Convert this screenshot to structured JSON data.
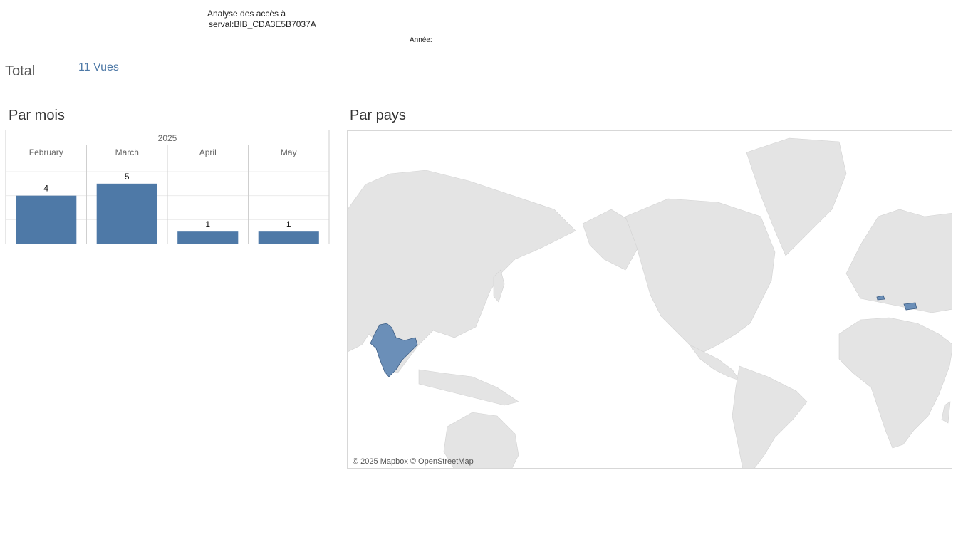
{
  "header": {
    "title_line1": "Analyse des accès à",
    "title_line2": "serval:BIB_CDA3E5B7037A",
    "year_filter_label": "Année:"
  },
  "summary": {
    "total_label": "Total",
    "total_value": "11 Vues"
  },
  "sections": {
    "months_heading": "Par mois",
    "countries_heading": "Par pays"
  },
  "chart_data": {
    "type": "bar",
    "year_header": "2025",
    "categories": [
      "February",
      "March",
      "April",
      "May"
    ],
    "values": [
      4,
      5,
      1,
      1
    ],
    "ylim": [
      0,
      6
    ],
    "grid": true,
    "bar_color": "#4e79a7"
  },
  "map": {
    "attribution": "© 2025 Mapbox © OpenStreetMap",
    "land_color": "#e4e4e4",
    "highlight_color": "#6b8fb8",
    "highlighted_regions": [
      "india",
      "bulgaria",
      "switzerland"
    ]
  }
}
